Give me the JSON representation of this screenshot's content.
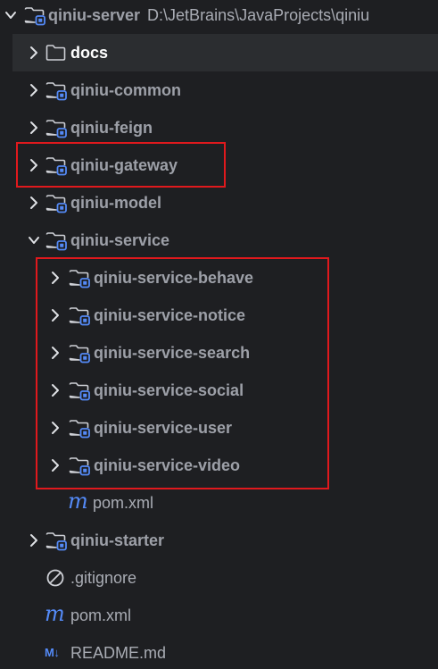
{
  "colors": {
    "background": "#1e1f22",
    "selection": "#2b2d30",
    "folder_outline": "#9da0a8",
    "module_badge": "#548af7",
    "label_text": "#9da0a8",
    "highlight_box": "#e0191d"
  },
  "tree": {
    "root": {
      "name": "qiniu-server",
      "path": "D:\\JetBrains\\JavaProjects\\qiniu",
      "expanded": true
    },
    "docs": {
      "name": "docs",
      "selected": true,
      "expanded": false
    },
    "common": {
      "name": "qiniu-common",
      "expanded": false
    },
    "feign": {
      "name": "qiniu-feign",
      "expanded": false
    },
    "gateway": {
      "name": "qiniu-gateway",
      "expanded": false
    },
    "model": {
      "name": "qiniu-model",
      "expanded": false
    },
    "service": {
      "name": "qiniu-service",
      "expanded": true,
      "children": [
        {
          "name": "qiniu-service-behave",
          "expanded": false
        },
        {
          "name": "qiniu-service-notice",
          "expanded": false
        },
        {
          "name": "qiniu-service-search",
          "expanded": false
        },
        {
          "name": "qiniu-service-social",
          "expanded": false
        },
        {
          "name": "qiniu-service-user",
          "expanded": false
        },
        {
          "name": "qiniu-service-video",
          "expanded": false
        }
      ],
      "pom": {
        "name": "pom.xml",
        "icon_glyph": "m"
      }
    },
    "starter": {
      "name": "qiniu-starter",
      "expanded": false
    },
    "gitignore": {
      "name": ".gitignore"
    },
    "pom": {
      "name": "pom.xml",
      "icon_glyph": "m"
    },
    "readme": {
      "name": "README.md",
      "icon_glyph": "M↓"
    }
  },
  "icons": {
    "chevron_collapsed": "chevron-right-icon",
    "chevron_expanded": "chevron-down-icon",
    "folder": "folder-icon",
    "module_folder": "module-folder-icon",
    "maven": "maven-icon",
    "ignore": "ignore-file-icon",
    "markdown": "markdown-icon"
  }
}
